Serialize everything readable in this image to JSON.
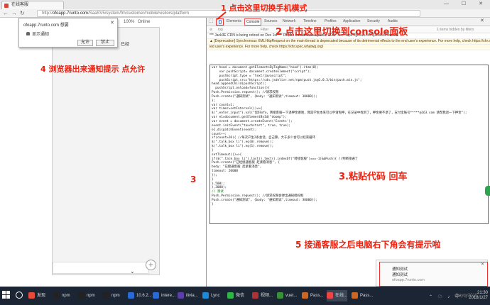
{
  "browser": {
    "tab_title": "在线客服",
    "window_controls": "— ☐ ✕",
    "url_host": "ofoapp.7runto.com",
    "url_prefix": "http://",
    "url_rest": "/SaaSV5/system/fm/customer/mobile/visitors/platform"
  },
  "device_toolbar": {
    "device": "Nexus 5",
    "zoom": "100%",
    "network": "Online"
  },
  "permission_popup": {
    "site": "ofoapp.7runto.com 想要",
    "close": "✕",
    "permission": "显示通知",
    "allow_label": "允许",
    "block_label": "禁止"
  },
  "behind_popup_text": "已经",
  "devtools": {
    "tabs": [
      "Elements",
      "Console",
      "Sources",
      "Network",
      "Timeline",
      "Profiles",
      "Application",
      "Security",
      "Audits"
    ],
    "active_tab": "Console",
    "filter_placeholder": "Filter",
    "context": "top",
    "preserve_log": "Preserve log",
    "hidden_count": "1 items hidden by filters",
    "messages": [
      "*** Jack3E CDN is being retired on Dec 1st *** Please transition to a public CDN. See https://github.com/jackbvb/Jack3E",
      "▲ [Deprecation] Synchronous XMLHttpRequest on the main thread is deprecated because of its detrimental effects to the end user's experience. For more help, check https://xhr.spec.whatwg.org/.",
      "  ied user's experience. For more help, check https://xhr.spec.whatwg.org/"
    ],
    "code_lines": [
      "var head = document.getElementsByTagName('head').item(0);",
      "    var pushScript= document.createElement(\"script\");",
      "    pushScript.type = \"text/javascript\";",
      "    pushScript.src=\"https://cdn.jsdelivr.net/npm/push.js@1.0.3/bin/push.min.js\";",
      "head.appendChild(pushScript);",
      "  pushScript.onload=function(){",
      "Push.Permission.request(); //请求权限",
      "Push.create(\"通知测试\", {body: \"通知测试\",timeout: 30000});",
      "};",
      "var count=1;",
      "var timer=setInterval(()=>{",
      "$(\".enter_input\").val(\"您好ofo，转接客服一下退押金谢谢，我是学生本来可以申请免押，在记录中找到了，押金要不退了，支付宝账号*****@163.com 请帮我退一下押金\");",
      "var e1=document.getElementById(\"doomp\");",
      "var event = document.createEvent('Events');",
      "event.initEvent(\"touchstart\", true, true);",
      "e1.dispatchEvent(event);",
      "count++;",
      "if(count>20){ //每次产生2条会话，自己算，大于多少会可以结束循环",
      "$(\".talk_box li\").eq(0).remove();",
      "$(\".talk_box li\").eq(1).remove();",
      "}",
      "setTimeout(()=>{",
      "if($(\".talk_box li\").last().text().indexOf(\"转接客服\")===-1)&&Push){ //判断接通了",
      "Push.create(\"已经接通客服 赶紧看消息\", {",
      "body: \"已接通客服 赶紧看消息\",",
      "timeout: 20000",
      "});",
      "}",
      "},500);",
      "},3000);",
      "",
      "// 测试",
      "Push.Permission.request(); //请求权限会弹出通知授权框",
      "Push.create(\"通知测试\", {body: \"通知测试\",timeout: 30000});",
      "}"
    ]
  },
  "annotations": {
    "a1": "1 点击这里切换手机模式",
    "a2": "2 点击这里切换到console面板",
    "a3": "3",
    "a3b": "3.粘贴代码 回车",
    "a4": "4 浏览器出来通知提示 点允许",
    "a5": "5 接通客服之后电脑右下角会有提示啦"
  },
  "notification": {
    "title": "通知测试",
    "body": "通知测试",
    "site": "ofoapp.7runto.com",
    "close": "✕"
  },
  "taskbar": {
    "items": [
      {
        "label": "发现",
        "color": "#ea4a3a"
      },
      {
        "label": "npm",
        "color": "#222"
      },
      {
        "label": "npm",
        "color": "#222"
      },
      {
        "label": "npm",
        "color": "#222"
      },
      {
        "label": "10.6.2...",
        "color": "#2a6ad6"
      },
      {
        "label": "intere...",
        "color": "#2a6ad6"
      },
      {
        "label": "ilivia...",
        "color": "#5b3fa8"
      },
      {
        "label": "Lync",
        "color": "#1c8ad6"
      },
      {
        "label": "微信",
        "color": "#2fb548"
      },
      {
        "label": "视频...",
        "color": "#a33"
      },
      {
        "label": "vuet...",
        "color": "#3a8f3a"
      },
      {
        "label": "Pass...",
        "color": "#c62"
      },
      {
        "label": "在线...",
        "color": "#e44"
      },
      {
        "label": "Pass...",
        "color": "#c62"
      }
    ],
    "tray": "⌃ ☁ ♪ 中",
    "clock_time": "21:30",
    "clock_date": "2018/1/27"
  },
  "watermark": "@ayqy2010"
}
